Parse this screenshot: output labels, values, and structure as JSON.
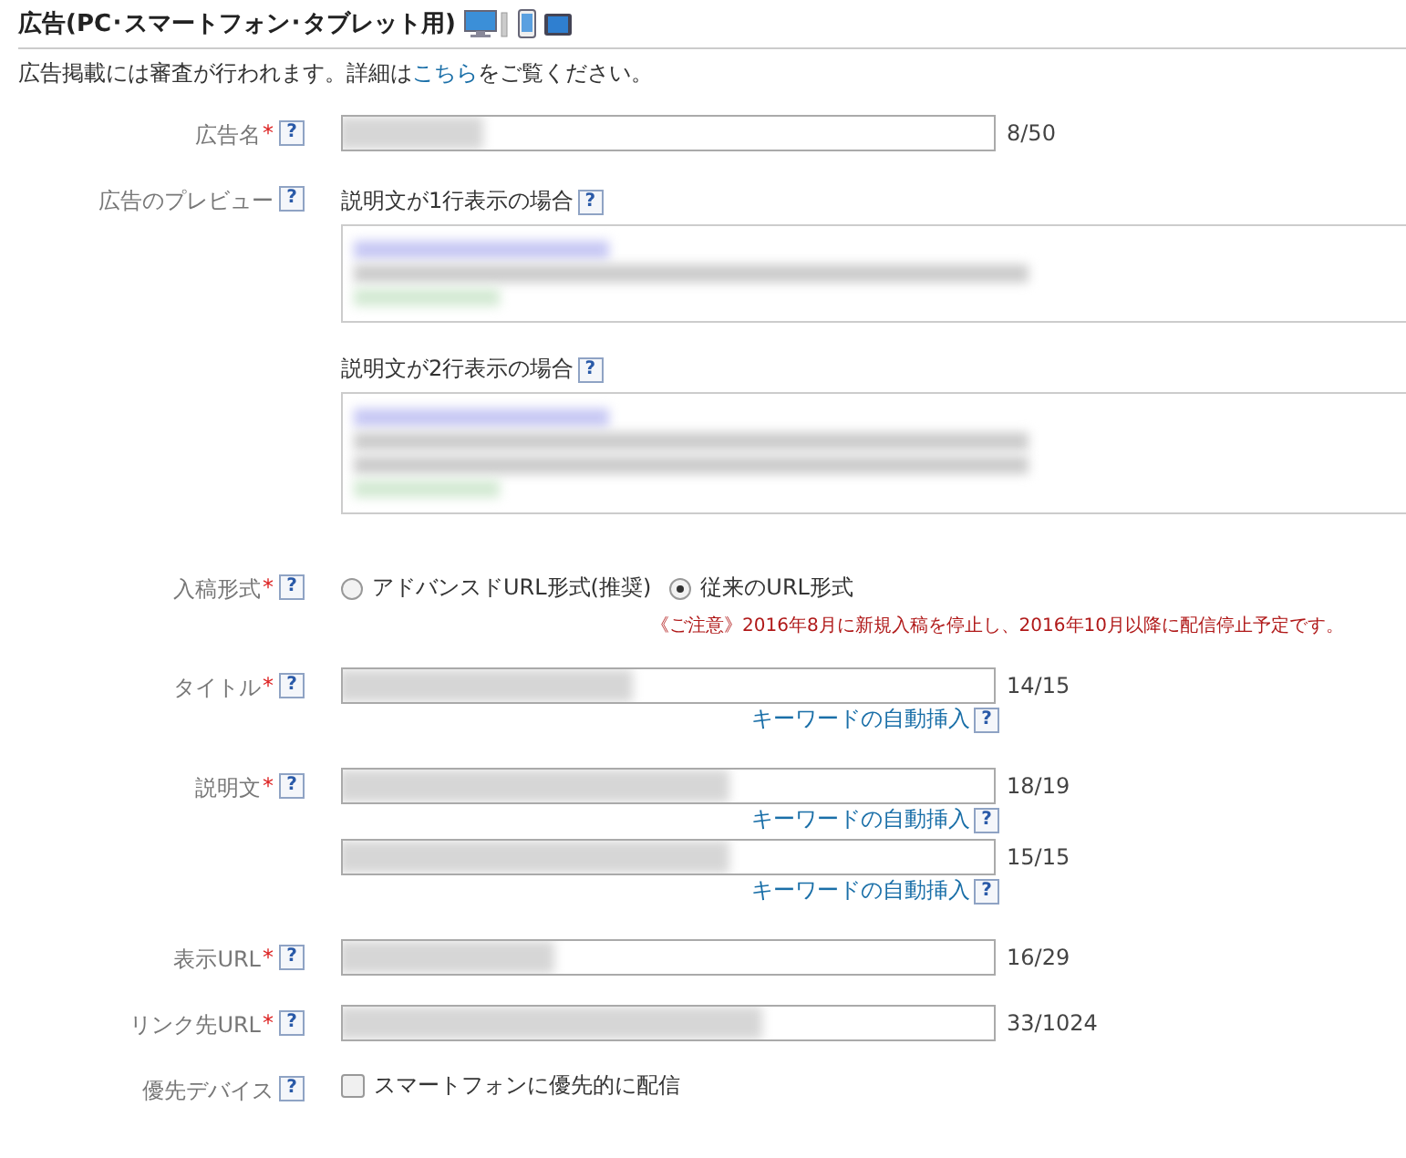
{
  "header": {
    "title": "広告(PC･スマートフォン･タブレット用)"
  },
  "notice": {
    "before": "広告掲載には審査が行われます。詳細は",
    "link": "こちら",
    "after": "をご覧ください。"
  },
  "fields": [
    {
      "kind": "text",
      "label": "広告名",
      "mark": "*",
      "help": "?",
      "inputs": [
        {
          "count": "8/50"
        }
      ]
    },
    {
      "kind": "preview",
      "label": "広告のプレビュー",
      "help": "?",
      "previews": [
        {
          "caption": "説明文が1行表示の場合",
          "help": "?"
        },
        {
          "caption": "説明文が2行表示の場合",
          "help": "?"
        }
      ]
    },
    {
      "kind": "radio",
      "label": "入稿形式",
      "mark": "*",
      "help": "?",
      "options": [
        {
          "label": "アドバンスドURL形式(推奨)",
          "selected": false
        },
        {
          "label": "従来のURL形式",
          "selected": true
        }
      ],
      "warning": "《ご注意》2016年8月に新規入稿を停止し、2016年10月以降に配信停止予定です。"
    },
    {
      "kind": "text",
      "label": "タイトル",
      "mark": "*",
      "help": "?",
      "inputs": [
        {
          "count": "14/15",
          "link": "キーワードの自動挿入",
          "help": "?"
        }
      ]
    },
    {
      "kind": "text",
      "label": "説明文",
      "mark": "*",
      "help": "?",
      "inputs": [
        {
          "count": "18/19",
          "link": "キーワードの自動挿入",
          "help": "?"
        },
        {
          "count": "15/15",
          "link": "キーワードの自動挿入",
          "help": "?"
        }
      ]
    },
    {
      "kind": "text",
      "label": "表示URL",
      "mark": "*",
      "help": "?",
      "inputs": [
        {
          "count": "16/29"
        }
      ]
    },
    {
      "kind": "text",
      "label": "リンク先URL",
      "mark": "*",
      "help": "?",
      "inputs": [
        {
          "count": "33/1024"
        }
      ]
    },
    {
      "kind": "checkbox",
      "label": "優先デバイス",
      "help": "?",
      "option": {
        "label": "スマートフォンに優先的に配信",
        "checked": false
      }
    }
  ]
}
